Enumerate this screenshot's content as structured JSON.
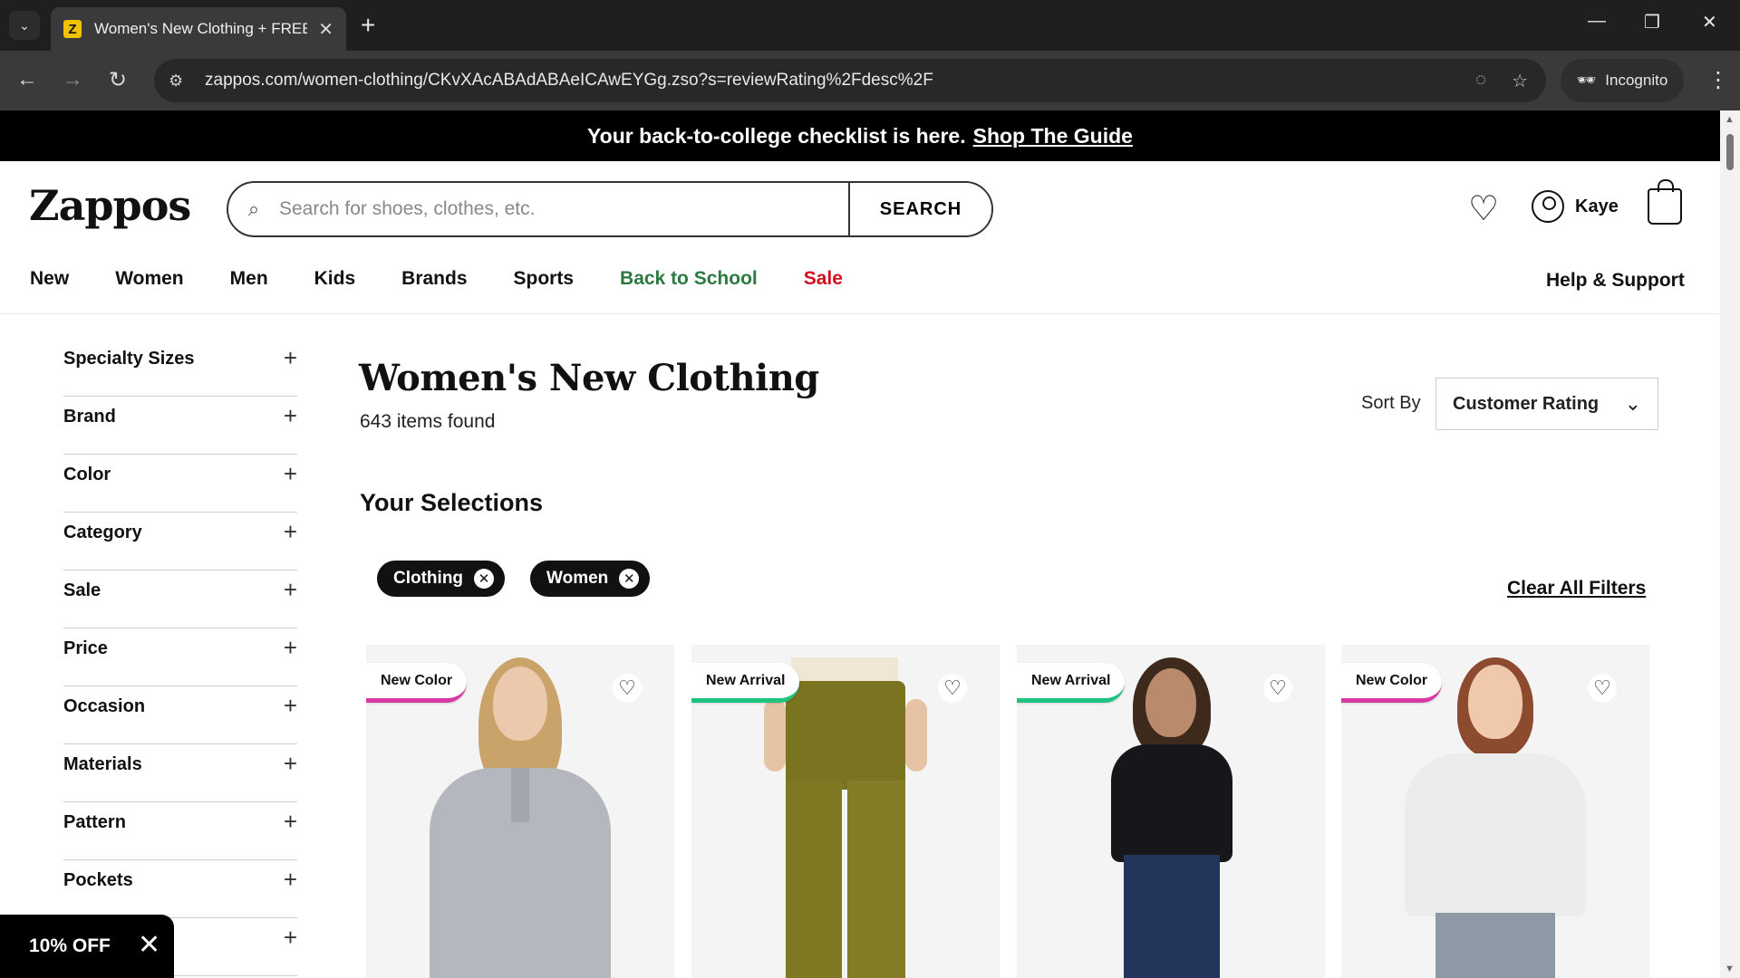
{
  "browser": {
    "tab_title": "Women's New Clothing + FREE",
    "favicon_letter": "Z",
    "url": "zappos.com/women-clothing/CKvXAcABAdABAeICAwEYGg.zso?s=reviewRating%2Fdesc%2F",
    "incognito_label": "Incognito"
  },
  "promo": {
    "text": "Your back-to-college checklist is here.",
    "link": "Shop The Guide"
  },
  "header": {
    "logo": "Zappos",
    "search_placeholder": "Search for shoes, clothes, etc.",
    "search_button": "SEARCH",
    "user_name": "Kaye"
  },
  "nav": {
    "items": [
      "New",
      "Women",
      "Men",
      "Kids",
      "Brands",
      "Sports",
      "Back to School",
      "Sale"
    ],
    "help": "Help & Support"
  },
  "filters": [
    "Specialty Sizes",
    "Brand",
    "Color",
    "Category",
    "Sale",
    "Price",
    "Occasion",
    "Materials",
    "Pattern",
    "Pockets",
    ""
  ],
  "main": {
    "title": "Women's New Clothing",
    "count": "643 items found",
    "sort_label": "Sort By",
    "sort_value": "Customer Rating",
    "selections_title": "Your Selections",
    "chips": [
      "Clothing",
      "Women"
    ],
    "clear_all": "Clear All Filters"
  },
  "products": [
    {
      "badge": "New Color",
      "badge_color": "#d63aa7"
    },
    {
      "badge": "New Arrival",
      "badge_color": "#1ec37f"
    },
    {
      "badge": "New Arrival",
      "badge_color": "#1ec37f"
    },
    {
      "badge": "New Color",
      "badge_color": "#d63aa7"
    }
  ],
  "offer": {
    "label": "10% OFF"
  },
  "colors": {
    "back_to_school": "#2c7a3f",
    "sale": "#d10f1f"
  }
}
